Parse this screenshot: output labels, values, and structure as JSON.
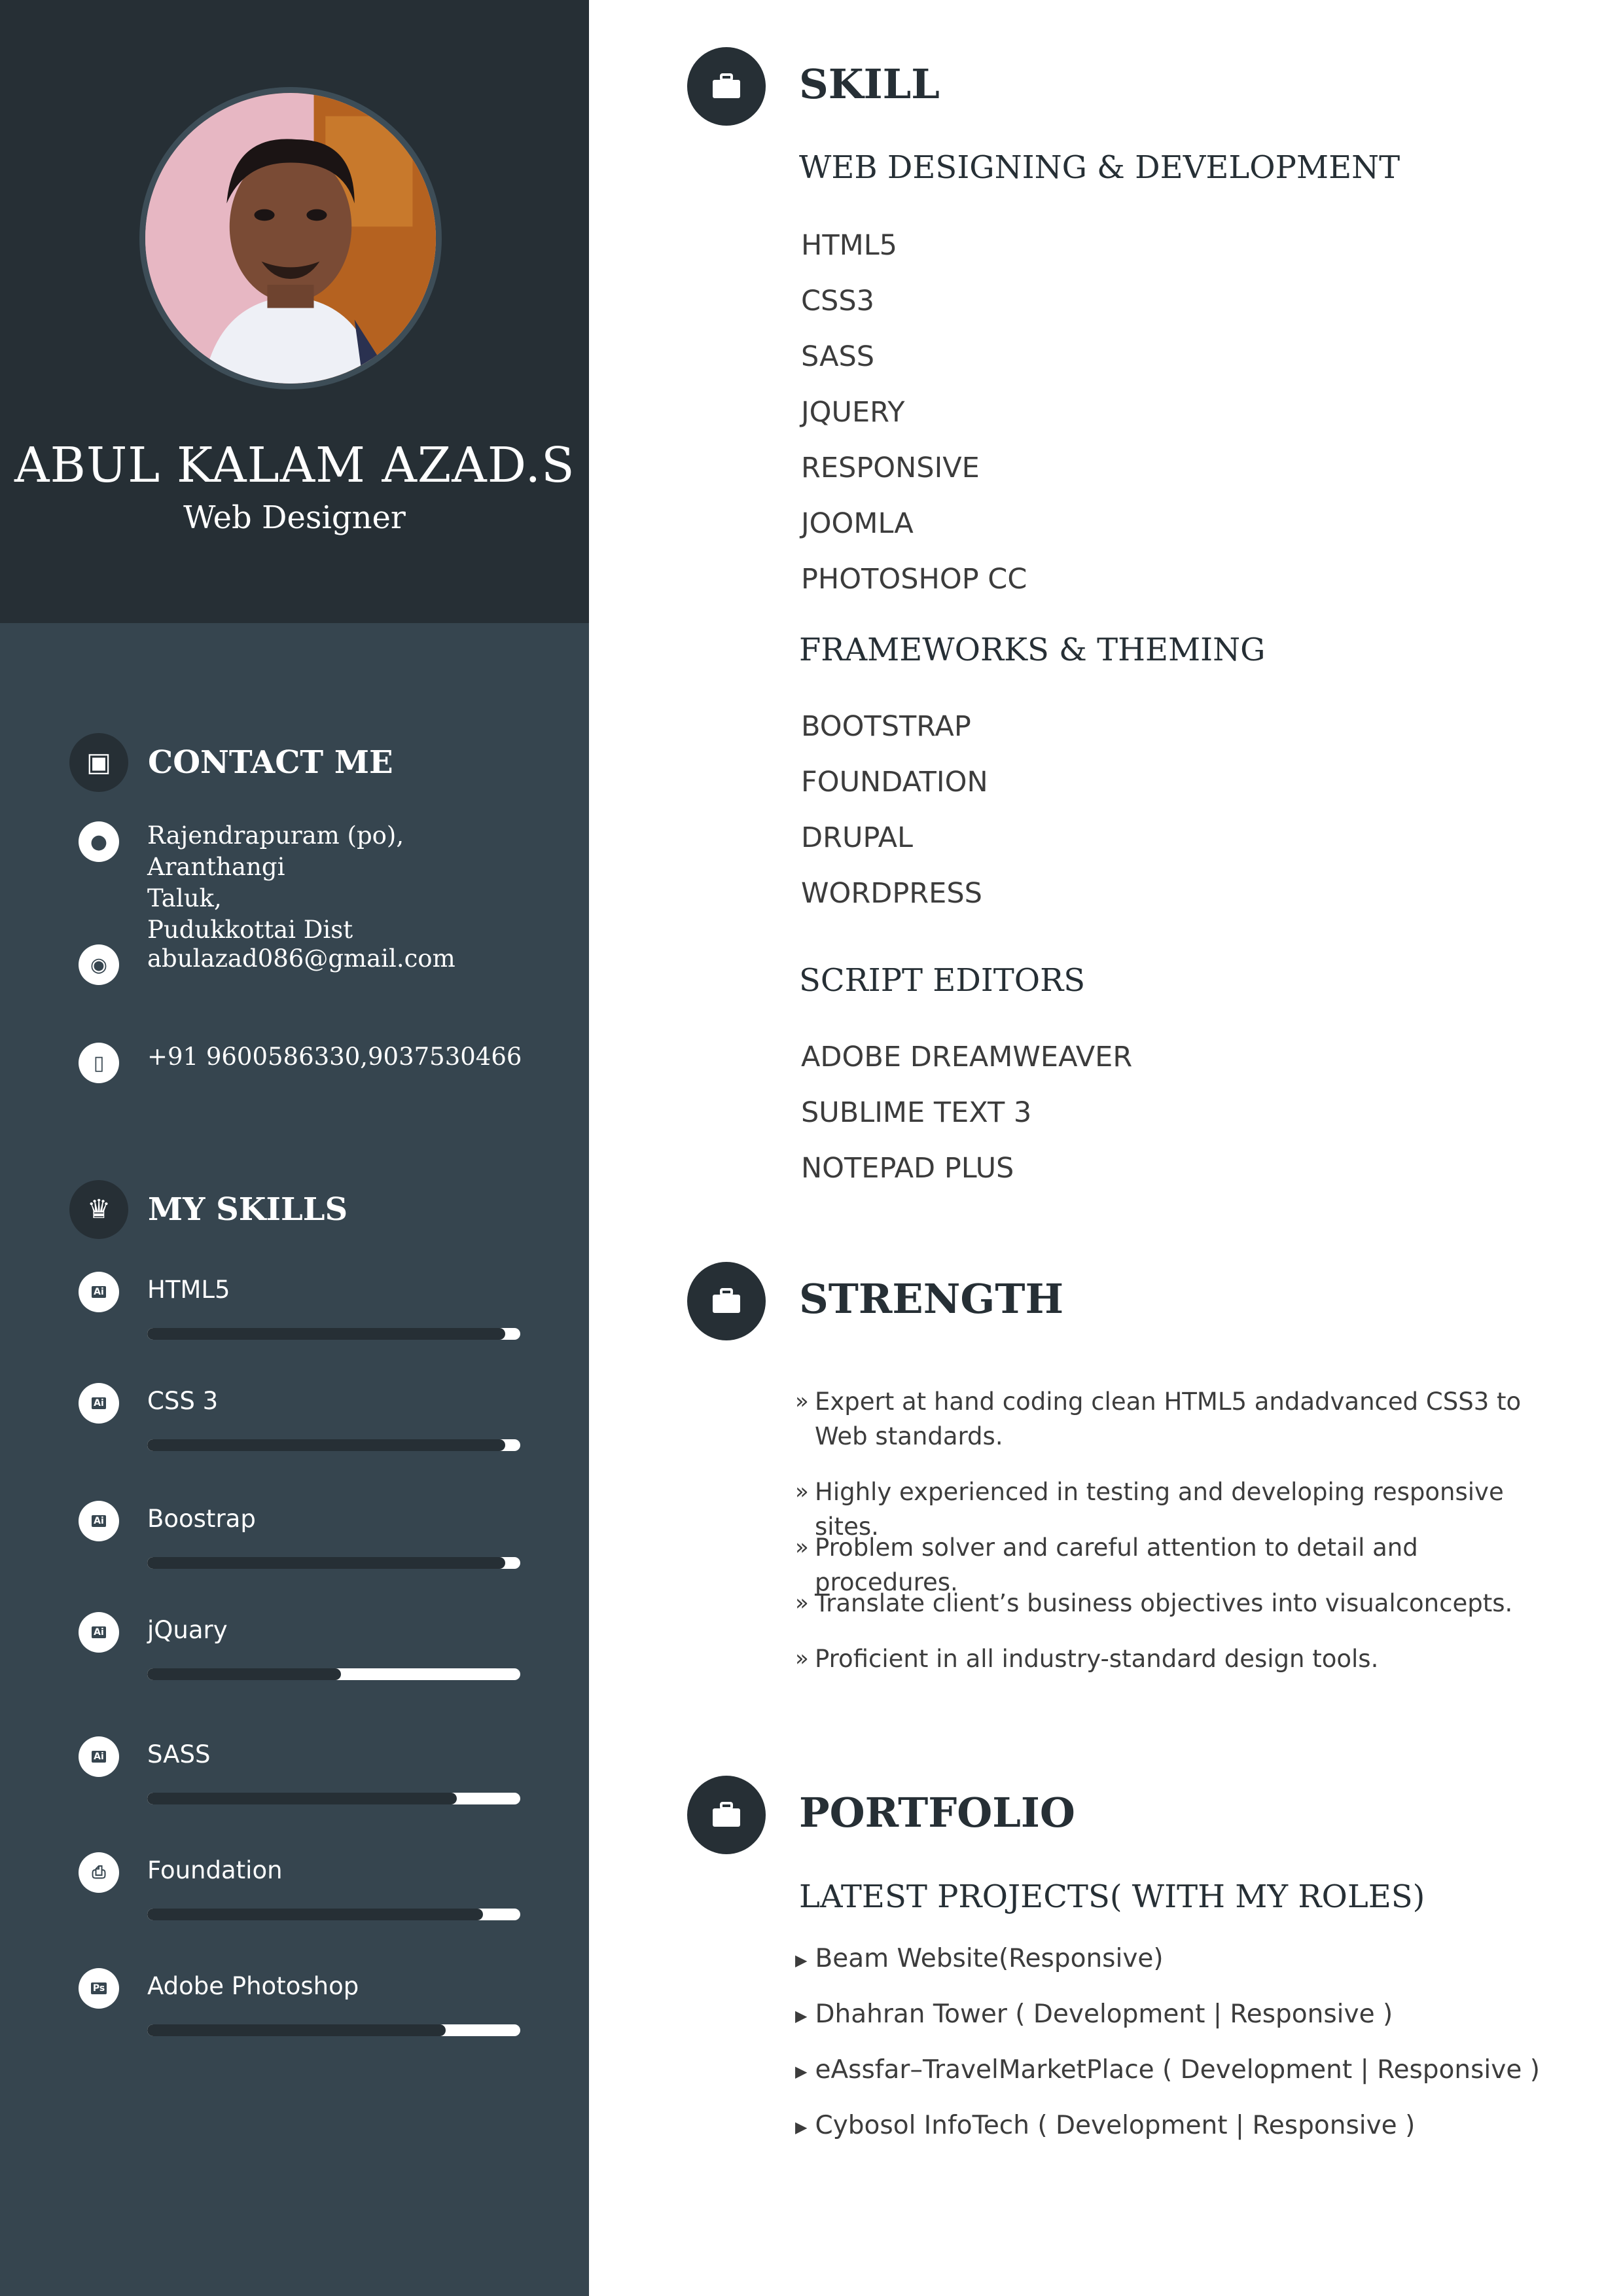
{
  "profile": {
    "name": "ABUL KALAM AZAD.S",
    "title": "Web Designer"
  },
  "contact": {
    "heading": "CONTACT ME",
    "address": "Rajendrapuram (po), Aranthangi\nTaluk,\nPudukkottai Dist",
    "email": "abulazad086@gmail.com",
    "phone": "+91 9600586330,9037530466"
  },
  "my_skills": {
    "heading": "MY SKILLS",
    "items": [
      {
        "label": "HTML5",
        "level": 0.96,
        "icon": "ai-file-icon"
      },
      {
        "label": "CSS 3",
        "level": 0.96,
        "icon": "ai-file-icon"
      },
      {
        "label": "Boostrap",
        "level": 0.96,
        "icon": "ai-file-icon"
      },
      {
        "label": "jQuary",
        "level": 0.52,
        "icon": "ai-file-icon"
      },
      {
        "label": "SASS",
        "level": 0.83,
        "icon": "ai-file-icon"
      },
      {
        "label": "Foundation",
        "level": 0.9,
        "icon": "printer-icon"
      },
      {
        "label": "Adobe Photoshop",
        "level": 0.8,
        "icon": "ps-file-icon"
      }
    ]
  },
  "skill": {
    "heading": "SKILL",
    "web_heading": "WEB DESIGNING & DEVELOPMENT",
    "web_items": [
      "HTML5",
      "CSS3",
      "SASS",
      "JQUERY",
      "RESPONSIVE",
      "JOOMLA",
      "PHOTOSHOP CC"
    ],
    "frameworks_heading": "FRAMEWORKS & THEMING",
    "frameworks_items": [
      "BOOTSTRAP",
      "FOUNDATION",
      "DRUPAL",
      "WORDPRESS"
    ],
    "editors_heading": "SCRIPT EDITORS",
    "editors_items": [
      "ADOBE DREAMWEAVER",
      "SUBLIME TEXT 3",
      "NOTEPAD PLUS"
    ]
  },
  "strength": {
    "heading": "STRENGTH",
    "bullet": "»",
    "items": [
      "Expert at hand coding clean HTML5 andadvanced CSS3 to Web standards.",
      "Highly experienced in testing and developing responsive sites.",
      "Problem solver and careful attention to detail  and procedures.",
      "Translate client’s business objectives into visualconcepts.",
      "Proficient in all industry-standard design tools."
    ]
  },
  "portfolio": {
    "heading": "PORTFOLIO",
    "subheading": "LATEST PROJECTS( WITH MY ROLES)",
    "items": [
      "Beam Website(Responsive)",
      "Dhahran Tower ( Development | Responsive )",
      "eAssfar–TravelMarketPlace ( Development | Responsive )",
      "Cybosol InfoTech ( Development | Responsive )"
    ]
  },
  "colors": {
    "sidebar_dark": "#262f35",
    "sidebar_mid": "#36454f",
    "text_dark": "#262f35"
  }
}
